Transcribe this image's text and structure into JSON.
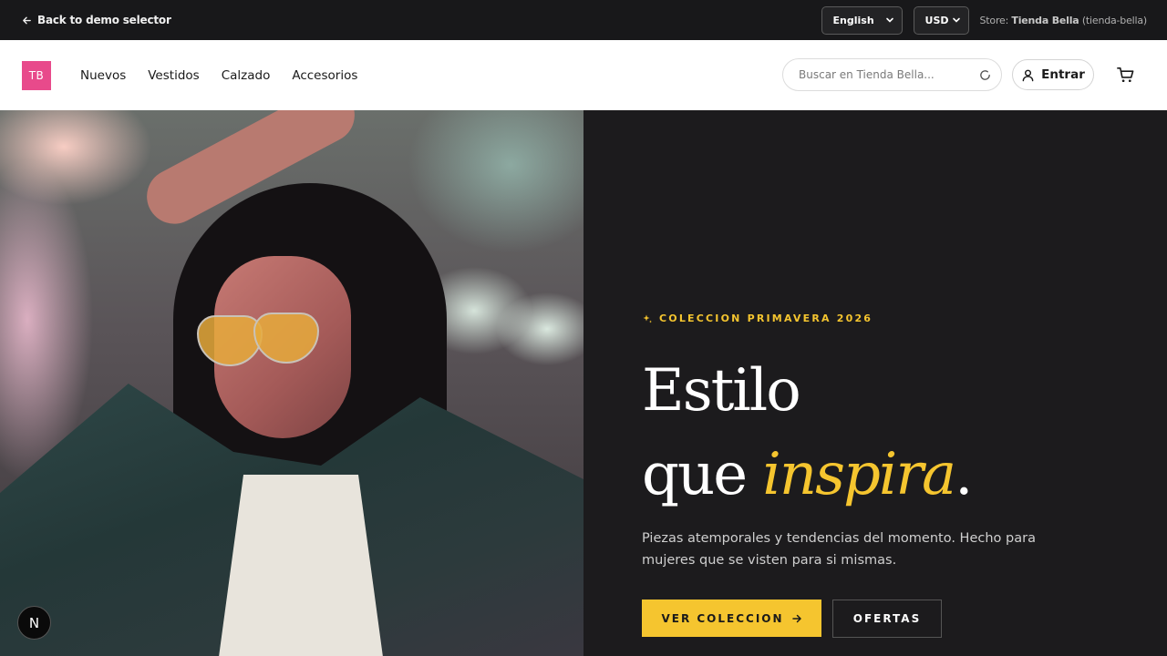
{
  "demo_bar": {
    "back_label": "Back to demo selector",
    "language": "English",
    "currency": "USD",
    "store_prefix": "Store:",
    "store_name": "Tienda Bella",
    "store_slug": "(tienda-bella)"
  },
  "header": {
    "logo_text": "TB",
    "logo_color": "#e84a8b",
    "nav": [
      "Nuevos",
      "Vestidos",
      "Calzado",
      "Accesorios"
    ],
    "search_placeholder": "Buscar en Tienda Bella...",
    "login_label": "Entrar"
  },
  "hero": {
    "eyebrow": "COLECCION PRIMAVERA 2026",
    "title_line1": "Estilo",
    "title_line2_start": "que ",
    "title_accent": "inspira",
    "title_end": ".",
    "subtitle": "Piezas atemporales y tendencias del momento. Hecho para mujeres que se visten para si mismas.",
    "primary_cta": "VER COLECCION",
    "secondary_cta": "OFERTAS",
    "accent_color": "#f5c52f"
  },
  "badge": {
    "label": "N"
  }
}
